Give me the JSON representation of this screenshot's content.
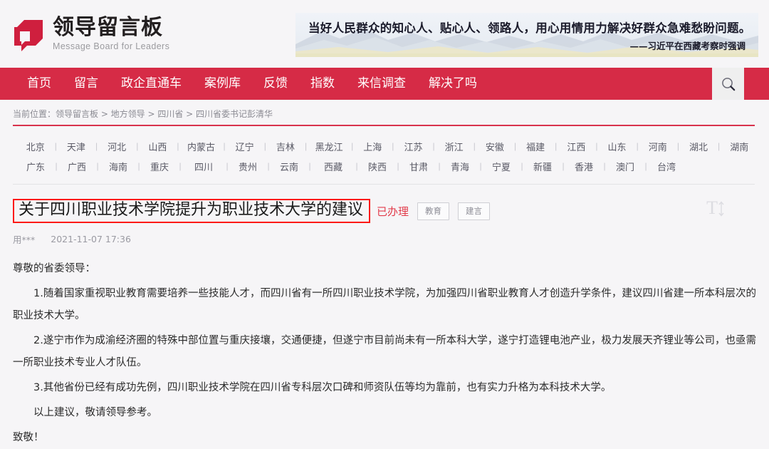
{
  "site": {
    "logo_icon": "speech-bubble-logo-icon",
    "name_cn": "领导留言板",
    "name_en": "Message Board for Leaders",
    "brand_color": "#d62b46"
  },
  "banner": {
    "quote": "当好人民群众的知心人、贴心人、领路人，用心用情用力解决好群众急难愁盼问题。",
    "attribution": "——习近平在西藏考察时强调"
  },
  "nav": {
    "items": [
      {
        "label": "首页"
      },
      {
        "label": "留言"
      },
      {
        "label": "政企直通车"
      },
      {
        "label": "案例库"
      },
      {
        "label": "反馈"
      },
      {
        "label": "指数"
      },
      {
        "label": "来信调查"
      },
      {
        "label": "解决了吗"
      }
    ],
    "search_icon": "search-icon"
  },
  "breadcrumb": {
    "text": "当前位置：领导留言板 > 地方领导 > 四川省 > 四川省委书记彭清华"
  },
  "provinces": {
    "row1": [
      "北京",
      "天津",
      "河北",
      "山西",
      "内蒙古",
      "辽宁",
      "吉林",
      "黑龙江",
      "上海",
      "江苏",
      "浙江",
      "安徽",
      "福建",
      "江西",
      "山东",
      "河南",
      "湖北",
      "湖南"
    ],
    "row2": [
      "广东",
      "广西",
      "海南",
      "重庆",
      "四川",
      "贵州",
      "云南",
      "西藏",
      "陕西",
      "甘肃",
      "青海",
      "宁夏",
      "新疆",
      "香港",
      "澳门",
      "台湾"
    ],
    "separator": "|"
  },
  "post": {
    "title": "关于四川职业技术学院提升为职业技术大学的建议",
    "status": "已办理",
    "status_color": "#e23b4a",
    "tags": [
      "教育",
      "建言"
    ],
    "author": "用***",
    "datetime": "2021-11-07 17:36",
    "fontsize_tool_icon": "font-size-icon",
    "fontsize_glyph": "T",
    "body": [
      "尊敬的省委领导：",
      "1.随着国家重视职业教育需要培养一些技能人才，而四川省有一所四川职业技术学院，为加强四川省职业教育人才创造升学条件，建议四川省建一所本科层次的职业技术大学。",
      "2.遂宁市作为成渝经济圈的特殊中部位置与重庆接壤，交通便捷，但遂宁市目前尚未有一所本科大学，遂宁打造锂电池产业，极力发展天齐锂业等公司，也亟需一所职业技术专业人才队伍。",
      "3.其他省份已经有成功先例，四川职业技术学院在四川省专科层次口碑和师资队伍等均为靠前，也有实力升格为本科技术大学。",
      "以上建议，敬请领导参考。",
      "致敬！"
    ]
  }
}
